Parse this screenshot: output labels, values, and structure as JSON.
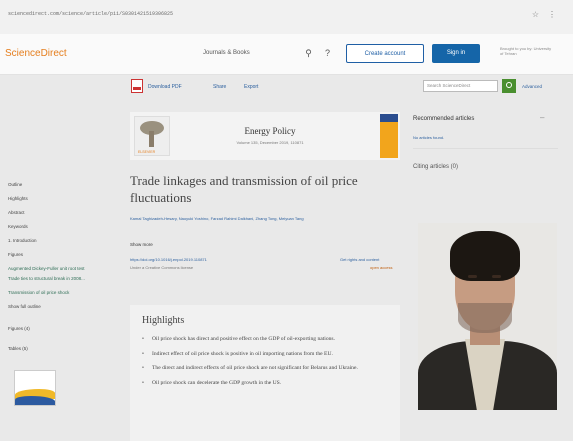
{
  "browser": {
    "url": "sciencedirect.com/science/article/pii/S0301421519306825"
  },
  "header": {
    "brand": "ScienceDirect",
    "journals_books": "Journals & Books",
    "create_account": "Create account",
    "sign_in": "Sign in",
    "institution": "Brought to you by: University of Tehran"
  },
  "toolbar": {
    "download_pdf": "Download PDF",
    "share": "Share",
    "export": "Export",
    "search_placeholder": "Search ScienceDirect",
    "advanced": "Advanced"
  },
  "sidebar": {
    "items": [
      {
        "label": "Outline"
      },
      {
        "label": "Highlights"
      },
      {
        "label": "Abstract"
      },
      {
        "label": "Keywords"
      },
      {
        "label": "1. Introduction"
      },
      {
        "label": "Figures"
      },
      {
        "label": "Augmented Dickey-Fuller unit root test"
      },
      {
        "label": "Trade ties to structural break in 2008..."
      },
      {
        "label": "Transmission of oil price shock"
      },
      {
        "label": "Show full outline"
      },
      {
        "label": "Figures (4)"
      },
      {
        "label": "Tables (5)"
      }
    ]
  },
  "journal": {
    "publisher": "ELSEVIER",
    "name": "Energy Policy",
    "volume": "Volume 135, December 2019, 110871"
  },
  "article": {
    "title": "Trade linkages and transmission of oil price fluctuations",
    "authors": "Kamal Taghizadeh-Hesary, Naoyuki Yoshino, Farzad Rahimi Dalkhani, Zhang Tong, Meiyuan Tang",
    "show_more": "Show more",
    "doi": "https://doi.org/10.1016/j.enpol.2019.110871",
    "rights": "Under a Creative Commons license",
    "get_rights": "Get rights and content",
    "open_access": "open access"
  },
  "highlights": {
    "title": "Highlights",
    "items": [
      "Oil price shock has direct and positive effect on the GDP of oil-exporting nations.",
      "Indirect effect of oil price shock is positive in oil importing nations from the EU.",
      "The direct and indirect effects of oil price shock are not significant for Belarus and Ukraine.",
      "Oil price shock can decelerate the GDP growth in the US."
    ]
  },
  "right_panel": {
    "recommended": "Recommended articles",
    "no_articles": "No articles found.",
    "citing": "Citing articles (0)"
  }
}
